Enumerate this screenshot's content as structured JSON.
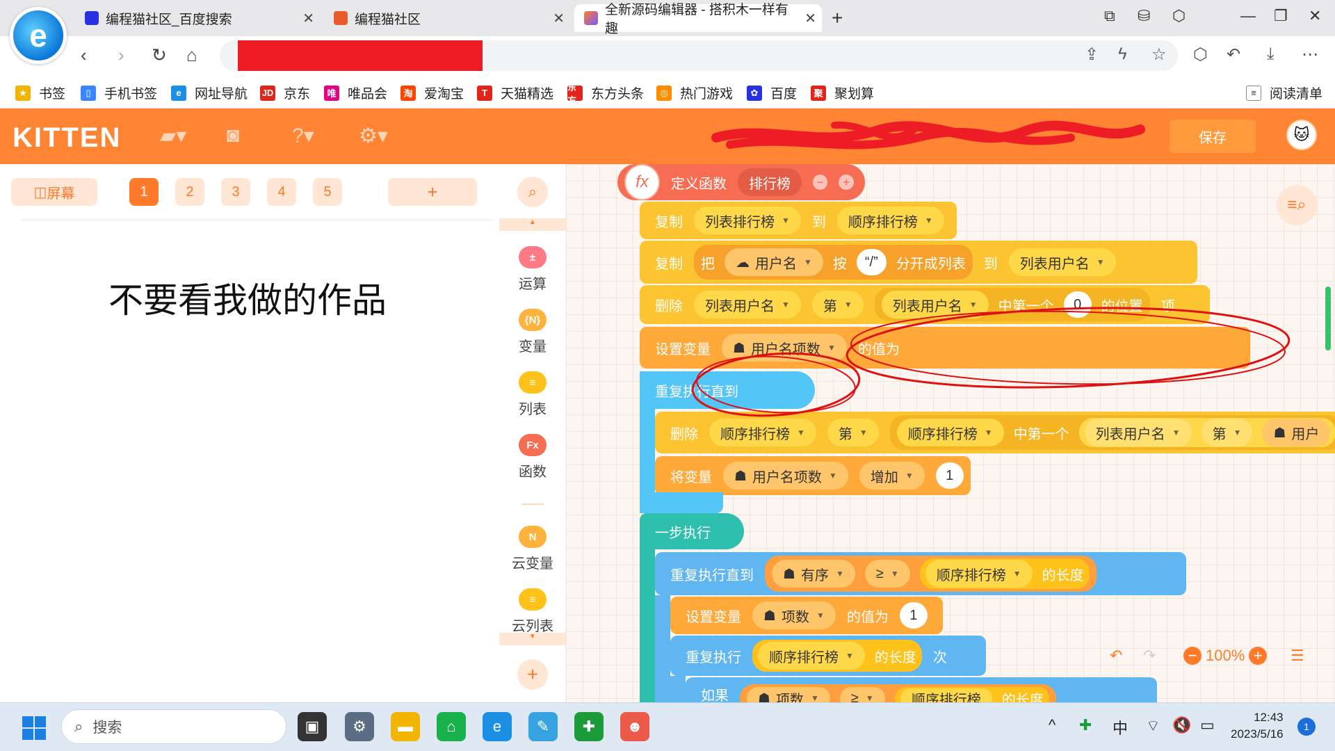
{
  "browser": {
    "tabs": [
      {
        "title": "编程猫社区_百度搜索",
        "favicon_color": "#2932e1"
      },
      {
        "title": "编程猫社区",
        "favicon_color": "#e85b2b"
      },
      {
        "title": "全新源码编辑器 - 搭积木一样有趣",
        "favicon_color": "#ff7a2a"
      }
    ],
    "bookmarks": [
      {
        "label": "书签",
        "color": "#f2b400",
        "glyph": "★"
      },
      {
        "label": "手机书签",
        "color": "#3a86ff",
        "glyph": "▯"
      },
      {
        "label": "网址导航",
        "color": "#1a8fe3",
        "glyph": "e"
      },
      {
        "label": "京东",
        "color": "#e1251b",
        "glyph": "JD"
      },
      {
        "label": "唯品会",
        "color": "#e4007f",
        "glyph": "唯"
      },
      {
        "label": "爱淘宝",
        "color": "#ff4400",
        "glyph": "淘"
      },
      {
        "label": "天猫精选",
        "color": "#e1251b",
        "glyph": "T"
      },
      {
        "label": "东方头条",
        "color": "#e1251b",
        "glyph": "东方"
      },
      {
        "label": "热门游戏",
        "color": "#ff8c00",
        "glyph": "◎"
      },
      {
        "label": "百度",
        "color": "#2932e1",
        "glyph": "✿"
      },
      {
        "label": "聚划算",
        "color": "#e1251b",
        "glyph": "聚"
      }
    ],
    "reading_list": "阅读清单"
  },
  "kitten": {
    "logo": "KITTEN",
    "save": "保存"
  },
  "stage": {
    "screen_button": "屏幕",
    "pages": [
      "1",
      "2",
      "3",
      "4",
      "5"
    ],
    "active_page": "1",
    "add": "+",
    "text": "不要看我做的作品"
  },
  "categories": [
    {
      "label": "运算",
      "color": "#ff7a85",
      "glyph": "±"
    },
    {
      "label": "变量",
      "color": "#ffb23d",
      "glyph": "{N}"
    },
    {
      "label": "列表",
      "color": "#ffc21a",
      "glyph": "≡"
    },
    {
      "label": "函数",
      "color": "#f76d53",
      "glyph": "Fx"
    },
    {
      "label": "云变量",
      "color": "#ffb23d",
      "glyph": "N"
    },
    {
      "label": "云列表",
      "color": "#ffc21a",
      "glyph": "≡"
    }
  ],
  "blocks": {
    "define_fn": {
      "keyword": "定义函数",
      "name": "排行榜"
    },
    "copy1": {
      "keyword": "复制",
      "src": "列表排行榜",
      "to": "到",
      "dst": "顺序排行榜"
    },
    "copy2": {
      "keyword": "复制",
      "ba": "把",
      "var": "用户名",
      "by": "按",
      "sep": "“/”",
      "split": "分开成列表",
      "to": "到",
      "dst": "列表用户名"
    },
    "delete1": {
      "keyword": "删除",
      "list": "列表用户名",
      "di": "第",
      "list2": "列表用户名",
      "first": "中第一个",
      "num": "0",
      "pos": "的位置",
      "item": "项"
    },
    "setvar1": {
      "keyword": "设置变量",
      "var": "用户名项数",
      "value": "的值为"
    },
    "repeat_until1": {
      "keyword": "重复执行直到"
    },
    "delete2": {
      "keyword": "删除",
      "list": "顺序排行榜",
      "di": "第",
      "list2": "顺序排行榜",
      "first": "中第一个",
      "list3": "列表用户名",
      "di2": "第",
      "var": "用户"
    },
    "incvar": {
      "keyword": "将变量",
      "var": "用户名项数",
      "op": "增加",
      "num": "1"
    },
    "step": {
      "keyword": "一步执行"
    },
    "repeat_until2": {
      "keyword": "重复执行直到",
      "var": "有序",
      "cmp": "≥",
      "list": "顺序排行榜",
      "len": "的长度"
    },
    "setvar2": {
      "keyword": "设置变量",
      "var": "项数",
      "value": "的值为",
      "num": "1"
    },
    "repeat": {
      "keyword": "重复执行",
      "list": "顺序排行榜",
      "len": "的长度",
      "times": "次"
    },
    "if": {
      "keyword": "如果",
      "var": "项数",
      "cmp": "≥",
      "list": "顺序排行榜",
      "len": "的长度"
    }
  },
  "zoom": "100%",
  "taskbar": {
    "search_placeholder": "搜索",
    "ime": "中",
    "time": "12:43",
    "date": "2023/5/16",
    "notifications": "1"
  }
}
